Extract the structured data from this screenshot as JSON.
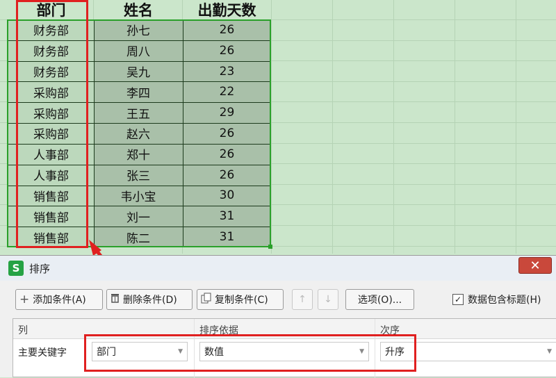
{
  "spreadsheet": {
    "headers": [
      "部门",
      "姓名",
      "出勤天数"
    ],
    "rows": [
      {
        "dept": "财务部",
        "name": "孙七",
        "days": "26"
      },
      {
        "dept": "财务部",
        "name": "周八",
        "days": "26"
      },
      {
        "dept": "财务部",
        "name": "吴九",
        "days": "23"
      },
      {
        "dept": "采购部",
        "name": "李四",
        "days": "22"
      },
      {
        "dept": "采购部",
        "name": "王五",
        "days": "29"
      },
      {
        "dept": "采购部",
        "name": "赵六",
        "days": "26"
      },
      {
        "dept": "人事部",
        "name": "郑十",
        "days": "26"
      },
      {
        "dept": "人事部",
        "name": "张三",
        "days": "26"
      },
      {
        "dept": "销售部",
        "name": "韦小宝",
        "days": "30"
      },
      {
        "dept": "销售部",
        "name": "刘一",
        "days": "31"
      },
      {
        "dept": "销售部",
        "name": "陈二",
        "days": "31"
      }
    ]
  },
  "dialog": {
    "app_icon": "S",
    "title": "排序",
    "close_glyph": "✕",
    "toolbar": {
      "add": "添加条件(A)",
      "delete": "删除条件(D)",
      "copy": "复制条件(C)",
      "up_glyph": "↑",
      "down_glyph": "↓",
      "options": "选项(O)...",
      "has_header_label": "数据包含标题(H)",
      "has_header_checked": "✓"
    },
    "columns": {
      "col": "列",
      "sort_on": "排序依据",
      "order": "次序"
    },
    "row": {
      "label": "主要关键字",
      "key": "部门",
      "sort_on": "数值",
      "order": "升序"
    }
  },
  "colors": {
    "sheet_bg": "#cbe6cb",
    "selection": "#2aa02a",
    "annotation": "#e02020"
  }
}
